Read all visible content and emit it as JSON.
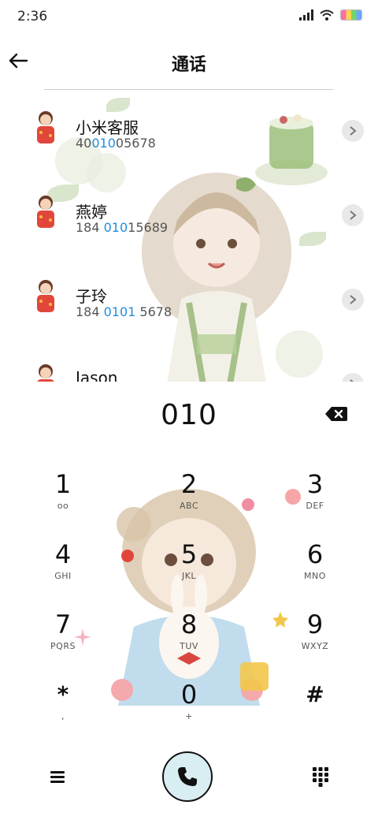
{
  "status_bar": {
    "time": "2:36"
  },
  "header": {
    "title": "通话"
  },
  "contacts": [
    {
      "name": "小米客服",
      "number_pre": "40",
      "number_match": "010",
      "number_post": "05678"
    },
    {
      "name": "燕婷",
      "number_pre": "184 ",
      "number_match": "010",
      "number_post": "15689"
    },
    {
      "name": "子玲",
      "number_pre": "184 ",
      "number_match": "0101",
      "number_post": " 5678"
    },
    {
      "name": "Jason",
      "number_pre": "",
      "number_match": "",
      "number_post": ""
    }
  ],
  "dialer": {
    "number": "010"
  },
  "keypad": [
    {
      "digit": "1",
      "letters": "oo"
    },
    {
      "digit": "2",
      "letters": "ABC"
    },
    {
      "digit": "3",
      "letters": "DEF"
    },
    {
      "digit": "4",
      "letters": "GHI"
    },
    {
      "digit": "5",
      "letters": "JKL"
    },
    {
      "digit": "6",
      "letters": "MNO"
    },
    {
      "digit": "7",
      "letters": "PQRS"
    },
    {
      "digit": "8",
      "letters": "TUV"
    },
    {
      "digit": "9",
      "letters": "WXYZ"
    },
    {
      "digit": "*",
      "letters": ","
    },
    {
      "digit": "0",
      "letters": "+"
    },
    {
      "digit": "#",
      "letters": ""
    }
  ],
  "colors": {
    "highlight": "#1f8ee0",
    "call_button_bg": "#d9eef2"
  },
  "icons": {
    "back": "arrow-left-icon",
    "backspace": "backspace-icon",
    "menu": "menu-icon",
    "call": "phone-icon",
    "dialpad": "dialpad-icon",
    "chevron": "chevron-right-icon"
  }
}
